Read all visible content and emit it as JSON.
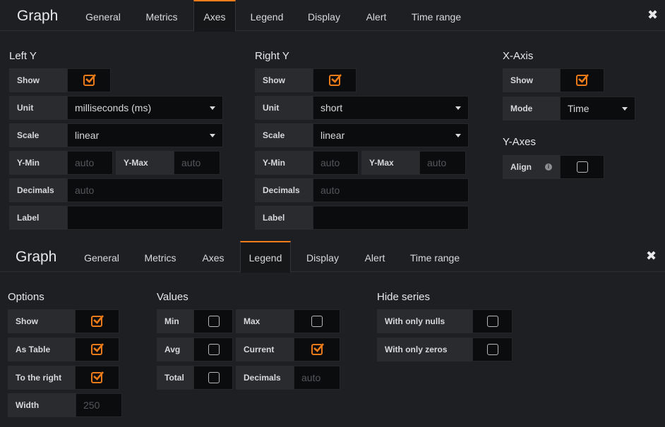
{
  "top": {
    "title": "Graph",
    "tabs": [
      "General",
      "Metrics",
      "Axes",
      "Legend",
      "Display",
      "Alert",
      "Time range"
    ],
    "active_tab": "Axes",
    "close": "✖",
    "left_y": {
      "title": "Left Y",
      "show_label": "Show",
      "show_checked": true,
      "unit_label": "Unit",
      "unit_value": "milliseconds (ms)",
      "scale_label": "Scale",
      "scale_value": "linear",
      "ymin_label": "Y-Min",
      "ymin_placeholder": "auto",
      "ymax_label": "Y-Max",
      "ymax_placeholder": "auto",
      "decimals_label": "Decimals",
      "decimals_placeholder": "auto",
      "label_label": "Label",
      "label_value": ""
    },
    "right_y": {
      "title": "Right Y",
      "show_label": "Show",
      "show_checked": true,
      "unit_label": "Unit",
      "unit_value": "short",
      "scale_label": "Scale",
      "scale_value": "linear",
      "ymin_label": "Y-Min",
      "ymin_placeholder": "auto",
      "ymax_label": "Y-Max",
      "ymax_placeholder": "auto",
      "decimals_label": "Decimals",
      "decimals_placeholder": "auto",
      "label_label": "Label",
      "label_value": ""
    },
    "x_axis": {
      "title": "X-Axis",
      "show_label": "Show",
      "show_checked": true,
      "mode_label": "Mode",
      "mode_value": "Time"
    },
    "y_axes": {
      "title": "Y-Axes",
      "align_label": "Align",
      "align_checked": false
    }
  },
  "bottom": {
    "title": "Graph",
    "tabs": [
      "General",
      "Metrics",
      "Axes",
      "Legend",
      "Display",
      "Alert",
      "Time range"
    ],
    "active_tab": "Legend",
    "close": "✖",
    "options": {
      "title": "Options",
      "show_label": "Show",
      "show_checked": true,
      "as_table_label": "As Table",
      "as_table_checked": true,
      "to_right_label": "To the right",
      "to_right_checked": true,
      "width_label": "Width",
      "width_placeholder": "250"
    },
    "values": {
      "title": "Values",
      "min_label": "Min",
      "min_checked": false,
      "max_label": "Max",
      "max_checked": false,
      "avg_label": "Avg",
      "avg_checked": false,
      "current_label": "Current",
      "current_checked": true,
      "total_label": "Total",
      "total_checked": false,
      "decimals_label": "Decimals",
      "decimals_placeholder": "auto"
    },
    "hide_series": {
      "title": "Hide series",
      "nulls_label": "With only nulls",
      "nulls_checked": false,
      "zeros_label": "With only zeros",
      "zeros_checked": false
    }
  },
  "colors": {
    "accent": "#eb7b18",
    "active_tab_border": "#f07c1c"
  }
}
